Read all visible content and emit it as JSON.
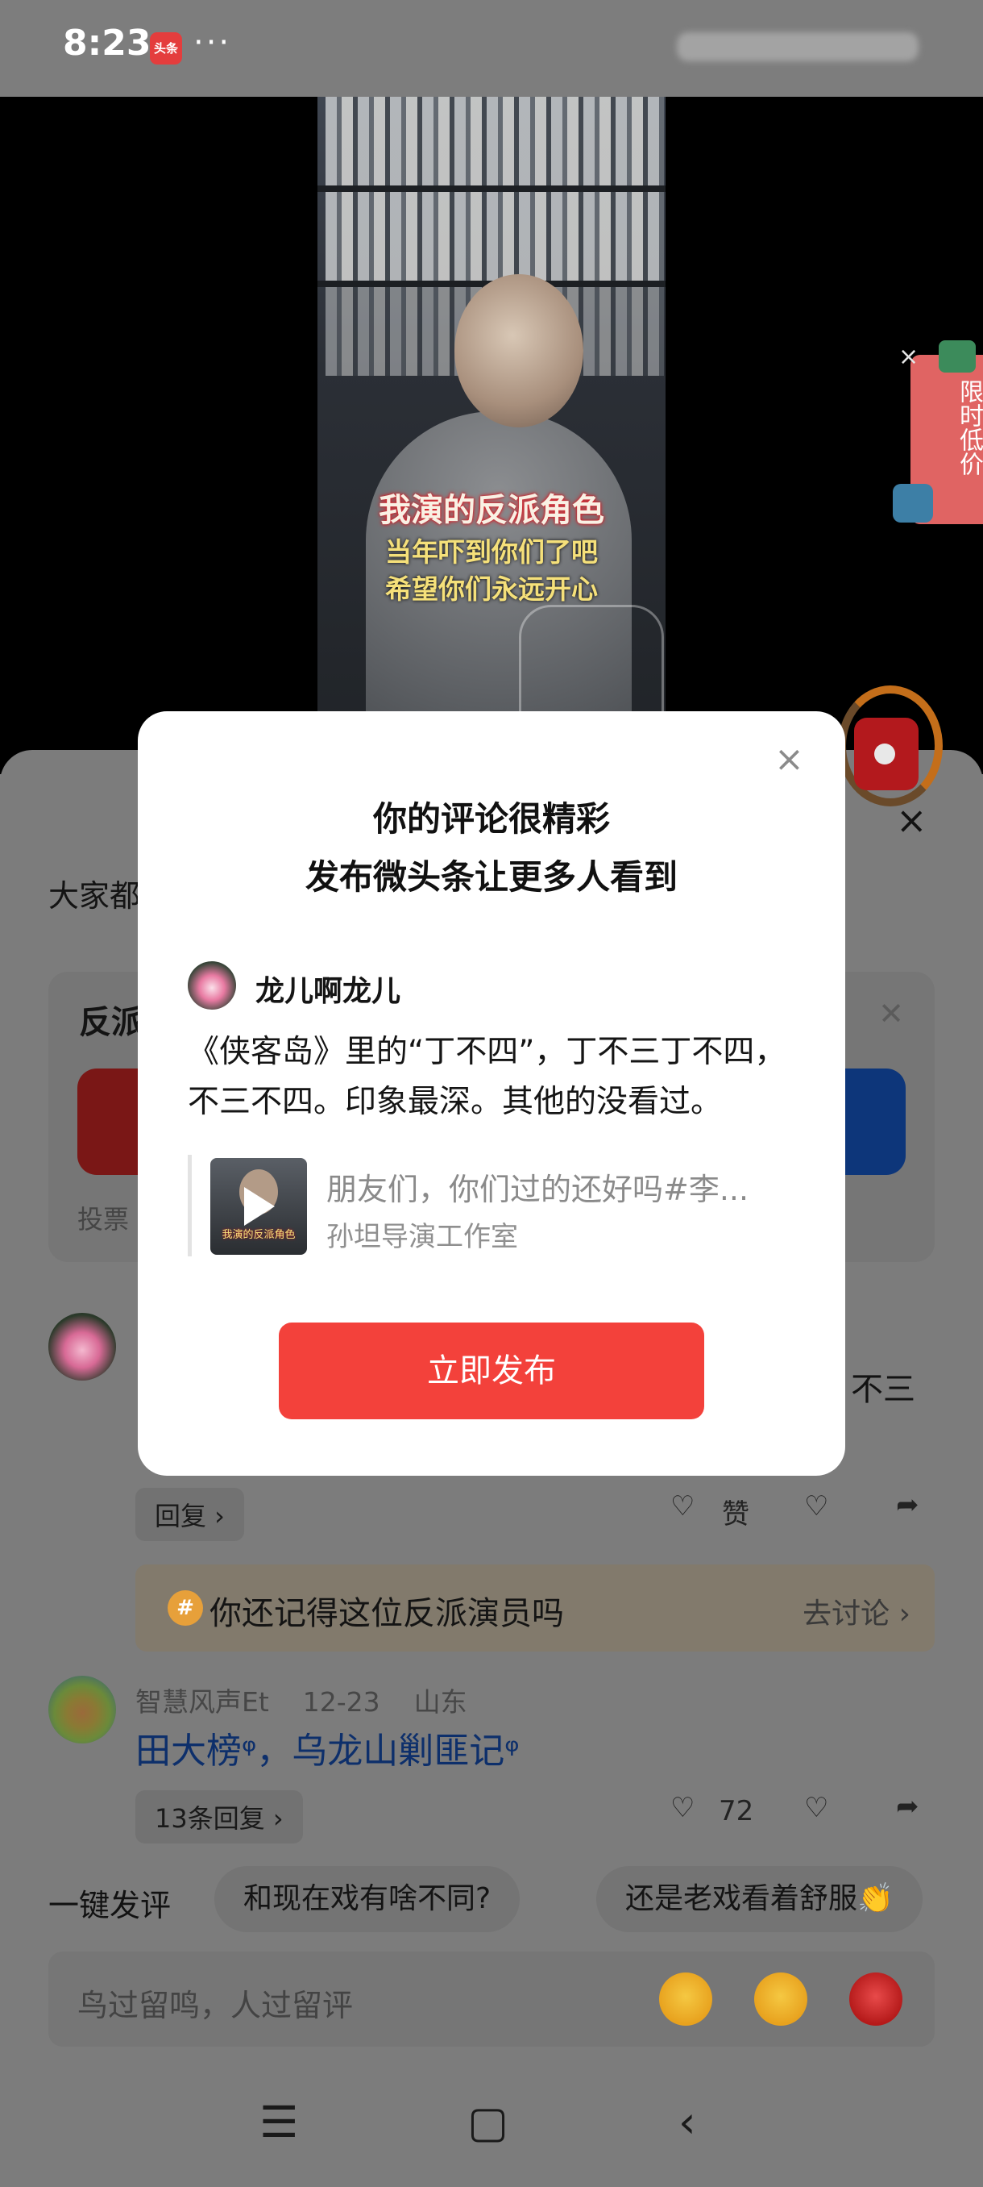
{
  "status_bar": {
    "time": "8:23",
    "app_badge": "头条",
    "more": "···"
  },
  "video": {
    "caption_line1": "我演的反派角色",
    "caption_line2": "当年吓到你们了吧",
    "caption_line3": "希望你们永远开心"
  },
  "promo": {
    "label": "限时低价",
    "close": "×"
  },
  "comments_sheet": {
    "close": "×",
    "title_partial": "大家都",
    "vote": {
      "title_partial": "反派",
      "footer_partial": "投票"
    },
    "comment1": {
      "tail_text": "不三",
      "reply_label": "回复 ›",
      "like_label": "赞"
    },
    "topic": {
      "icon": "#",
      "text": "你还记得这位反派演员吗",
      "link": "去讨论 ›"
    },
    "comment2": {
      "author": "智慧风声Et",
      "date": "12-23",
      "location": "山东",
      "text": "田大榜ᵠ，乌龙山剿匪记ᵠ",
      "replies_label": "13条回复 ›",
      "likes": "72"
    }
  },
  "quick_comment": {
    "label": "一键发评",
    "chips": [
      "和现在戏有啥不同?",
      "还是老戏看着舒服👏"
    ]
  },
  "input_bar": {
    "placeholder": "鸟过留鸣，人过留评"
  },
  "modal": {
    "close": "×",
    "title_line1": "你的评论很精彩",
    "title_line2": "发布微头条让更多人看到",
    "username": "龙儿啊龙儿",
    "comment": "《侠客岛》里的“丁不四”，丁不三丁不四，不三不四。印象最深。其他的没看过。",
    "quoted_title": "朋友们，你们过的还好吗#李...",
    "quoted_author": "孙坦导演工作室",
    "thumb_caption": "我演的反派角色",
    "publish_button": "立即发布"
  },
  "nav": {
    "menu": "☰",
    "home": "▢",
    "back": "‹"
  }
}
